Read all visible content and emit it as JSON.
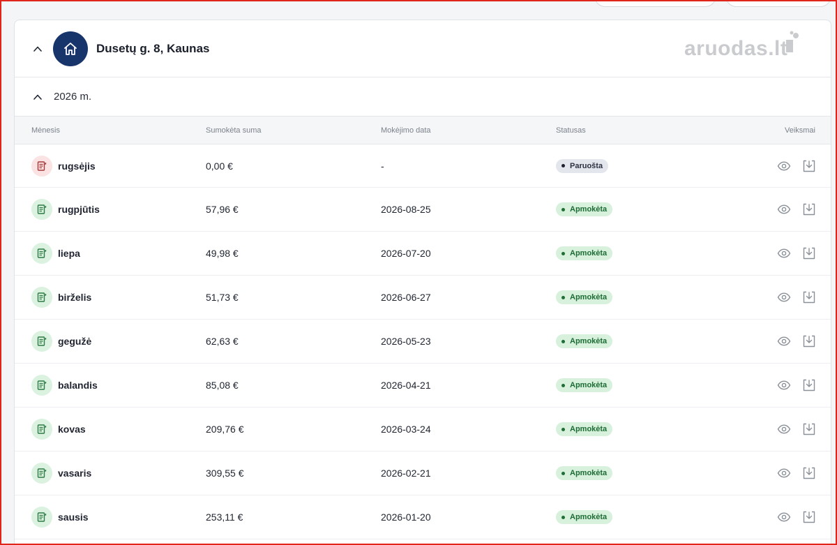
{
  "property": {
    "address": "Dusetų g. 8, Kaunas",
    "brand_logo": "aruodas.lt"
  },
  "year_group": {
    "label": "2026 m."
  },
  "table": {
    "headers": {
      "month": "Mėnesis",
      "amount": "Sumokėta suma",
      "date": "Mokėjimo data",
      "status": "Statusas",
      "actions": "Veiksmai"
    },
    "rows": [
      {
        "month": "rugsėjis",
        "amount": "0,00 €",
        "date": "-",
        "status": "Paruošta",
        "state": "ready"
      },
      {
        "month": "rugpjūtis",
        "amount": "57,96 €",
        "date": "2026-08-25",
        "status": "Apmokėta",
        "state": "paid"
      },
      {
        "month": "liepa",
        "amount": "49,98 €",
        "date": "2026-07-20",
        "status": "Apmokėta",
        "state": "paid"
      },
      {
        "month": "birželis",
        "amount": "51,73 €",
        "date": "2026-06-27",
        "status": "Apmokėta",
        "state": "paid"
      },
      {
        "month": "gegužė",
        "amount": "62,63 €",
        "date": "2026-05-23",
        "status": "Apmokėta",
        "state": "paid"
      },
      {
        "month": "balandis",
        "amount": "85,08 €",
        "date": "2026-04-21",
        "status": "Apmokėta",
        "state": "paid"
      },
      {
        "month": "kovas",
        "amount": "209,76 €",
        "date": "2026-03-24",
        "status": "Apmokėta",
        "state": "paid"
      },
      {
        "month": "vasaris",
        "amount": "309,55 €",
        "date": "2026-02-21",
        "status": "Apmokėta",
        "state": "paid"
      },
      {
        "month": "sausis",
        "amount": "253,11 €",
        "date": "2026-01-20",
        "status": "Apmokėta",
        "state": "paid"
      }
    ]
  },
  "icons": {
    "collapse": "chevron-up-icon",
    "property": "house-icon",
    "invoice": "document-icon",
    "view": "eye-icon",
    "download": "download-icon"
  },
  "colors": {
    "brand_navy": "#17356b",
    "paid_bg": "#d7f1dc",
    "paid_text": "#1c6b34",
    "ready_bg": "#e3e6ec",
    "ready_icon_bg": "#fbe3e3",
    "frame_border": "#e0261b"
  }
}
